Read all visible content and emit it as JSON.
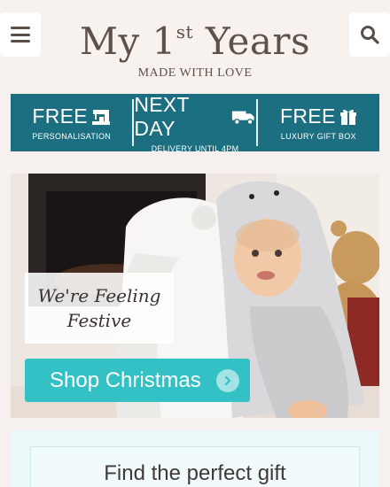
{
  "header": {
    "logo_text": "My 1",
    "logo_sup": "st",
    "logo_text_end": " Years",
    "tagline": "MADE WITH LOVE",
    "menu_icon": "hamburger-menu-icon",
    "search_icon": "search-icon"
  },
  "usp": [
    {
      "headline": "FREE",
      "icon": "sewing-machine-icon",
      "sub": "PERSONALISATION"
    },
    {
      "headline": "NEXT DAY",
      "icon": "delivery-truck-icon",
      "sub": "DELIVERY UNTIL 4PM"
    },
    {
      "headline": "FREE",
      "icon": "gift-box-icon",
      "sub": "LUXURY GIFT BOX"
    }
  ],
  "hero": {
    "festive_line1": "We're Feeling",
    "festive_line2": "Festive",
    "cta_label": "Shop Christmas",
    "cta_icon": "chevron-right-icon"
  },
  "finder": {
    "title": "Find the perfect gift"
  },
  "colors": {
    "header_bg": "#f8f2ef",
    "usp_bg": "#1c6f80",
    "cta_bg": "#33c1c5",
    "logo_text": "#5e514b"
  }
}
